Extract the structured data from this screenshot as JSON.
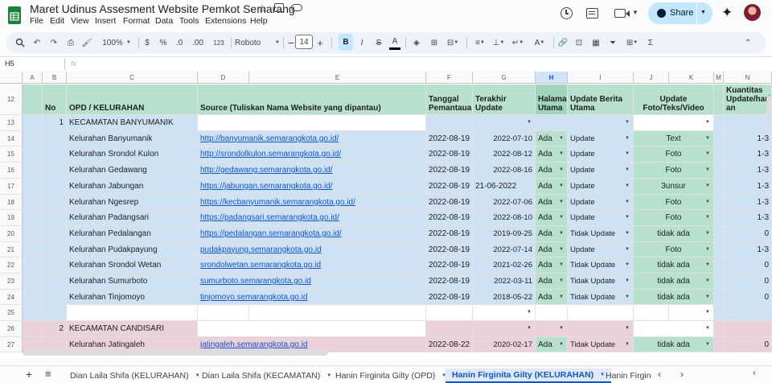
{
  "doc": {
    "title": "Maret Udinus Assesment Website Pemkot Semarang",
    "share_label": "Share"
  },
  "menu": [
    "File",
    "Edit",
    "View",
    "Insert",
    "Format",
    "Data",
    "Tools",
    "Extensions",
    "Help"
  ],
  "toolbar": {
    "zoom": "100%",
    "currency": "$",
    "percent": "%",
    "dec_less": ".0",
    "dec_more": ".00",
    "num_format": "123",
    "font": "Roboto",
    "font_size": "14",
    "bold": "B",
    "italic": "I",
    "strike": "S",
    "text_color": "A"
  },
  "formula": {
    "cell_ref": "H5",
    "fx": "fx"
  },
  "columns": [
    "A",
    "B",
    "C",
    "D",
    "E",
    "F",
    "G",
    "H",
    "I",
    "J",
    "K",
    "M",
    "N"
  ],
  "header_row": {
    "row_num": "12",
    "no": "No",
    "opd": "OPD / KELURAHAN",
    "source": "Source (Tuliskan Nama Website yang dipantau)",
    "tanggal": "Tanggal Pemantauan",
    "terakhir": "Terakhir Update",
    "halaman": "Halaman Utama",
    "update_berita": "Update Berita Utama",
    "update_foto": "Update Foto/Teks/Video",
    "kuantitas": "Kuantitas Update/hari an"
  },
  "rows": [
    {
      "row": "13",
      "no": "1",
      "name": "KECAMATAN BANYUMANIK",
      "type": "group"
    },
    {
      "row": "14",
      "name": "Kelurahan Banyumanik",
      "url": "http://banyumanik.semarangkota.go.id/",
      "tgl": "2022-08-19",
      "last": "2022-07-10",
      "hal": "Ada",
      "berita": "Update",
      "foto": "Text",
      "qty": "1-3"
    },
    {
      "row": "15",
      "name": "Kelurahan Srondol Kulon",
      "url": "http://srondolkulon.semarangkota.go.id/",
      "tgl": "2022-08-19",
      "last": "2022-08-12",
      "hal": "Ada",
      "berita": "Update",
      "foto": "Foto",
      "qty": "1-3"
    },
    {
      "row": "16",
      "name": "Kelurahan Gedawang",
      "url": "http://gedawang.semarangkota.go.id/",
      "tgl": "2022-08-19",
      "last": "2022-08-16",
      "hal": "Ada",
      "berita": "Update",
      "foto": "Foto",
      "qty": "1-3"
    },
    {
      "row": "17",
      "name": "Kelurahan Jabungan",
      "url": "https://jabungan.semarangkota.go.id/",
      "tgl": "2022-08-19",
      "last": "21-06-2022",
      "hal": "Ada",
      "berita": "Update",
      "foto": "3unsur",
      "qty": "1-3",
      "last_left": true
    },
    {
      "row": "18",
      "name": "Kelurahan Ngesrep",
      "url": "https://kecbanyumanik.semarangkota.go.id/",
      "tgl": "2022-08-19",
      "last": "2022-07-06",
      "hal": "Ada",
      "berita": "Update",
      "foto": "Foto",
      "qty": "1-3"
    },
    {
      "row": "19",
      "name": "Kelurahan Padangsari",
      "url": "https://padangsari.semarangkota.go.id/",
      "tgl": "2022-08-19",
      "last": "2022-08-10",
      "hal": "Ada",
      "berita": "Update",
      "foto": "Foto",
      "qty": "1-3"
    },
    {
      "row": "20",
      "name": "Kelurahan Pedalangan",
      "url": "https://pedalangan.semarangkota.go.id/",
      "tgl": "2022-08-19",
      "last": "2019-09-25",
      "hal": "Ada",
      "berita": "Tidak Update",
      "foto": "tidak ada",
      "qty": "0"
    },
    {
      "row": "21",
      "name": "Kelurahan Pudakpayung",
      "url": "pudakpayung.semarangkota.go.id",
      "tgl": "2022-08-19",
      "last": "2022-07-14",
      "hal": "Ada",
      "berita": "Update",
      "foto": "Foto",
      "qty": "1-3"
    },
    {
      "row": "22",
      "name": "Kelurahan Srondol Wetan",
      "url": "srondolwetan.semarangkota.go.id",
      "tgl": "2022-08-19",
      "last": "2021-02-26",
      "hal": "Ada",
      "berita": "Tidak Update",
      "foto": "tidak ada",
      "qty": "0"
    },
    {
      "row": "23",
      "name": "Kelurahan Sumurboto",
      "url": "sumurboto.semarangkota.go.id",
      "tgl": "2022-08-19",
      "last": "2022-03-11",
      "hal": "Ada",
      "berita": "Tidak Update",
      "foto": "tidak ada",
      "qty": "0"
    },
    {
      "row": "24",
      "name": "Kelurahan Tinjomoyo",
      "url": "tinjomoyo.semarangkota.go.id",
      "tgl": "2022-08-19",
      "last": "2018-05-22",
      "hal": "Ada",
      "berita": "Tidak Update",
      "foto": "tidak ada",
      "qty": "0"
    },
    {
      "row": "25",
      "type": "blank"
    },
    {
      "row": "26",
      "no": "2",
      "name": "KECAMATAN CANDISARI",
      "type": "group2"
    },
    {
      "row": "27",
      "name": "Kelurahan Jatingaleh",
      "url": "jatingaleh.semarangkota.go.id",
      "tgl": "2022-08-22",
      "last": "2020-02-17",
      "hal": "Ada",
      "berita": "Tidak Update",
      "foto": "tidak ada",
      "qty": "0",
      "pink": true
    }
  ],
  "sheet_tabs": [
    "Dian Laila Shifa (KELURAHAN)",
    "Dian Laila Shifa (KECAMATAN)",
    "Hanin Firginita Gilty (OPD)",
    "Hanin Firginita Gilty (KELURAHAN)",
    "Hanin Firgin"
  ],
  "active_tab_index": 3,
  "colors": {
    "accent": "#0b57d0",
    "header_green": "#b7e1cd",
    "cell_blue": "#cfe2f3",
    "cell_pink": "#ead1dc",
    "chip_green": "#b7e1cd"
  },
  "icons": [
    "sheets-logo-icon",
    "star-icon",
    "move-icon",
    "cloud-icon",
    "history-icon",
    "comment-icon",
    "video-icon",
    "globe-icon",
    "gemini-icon",
    "avatar"
  ]
}
